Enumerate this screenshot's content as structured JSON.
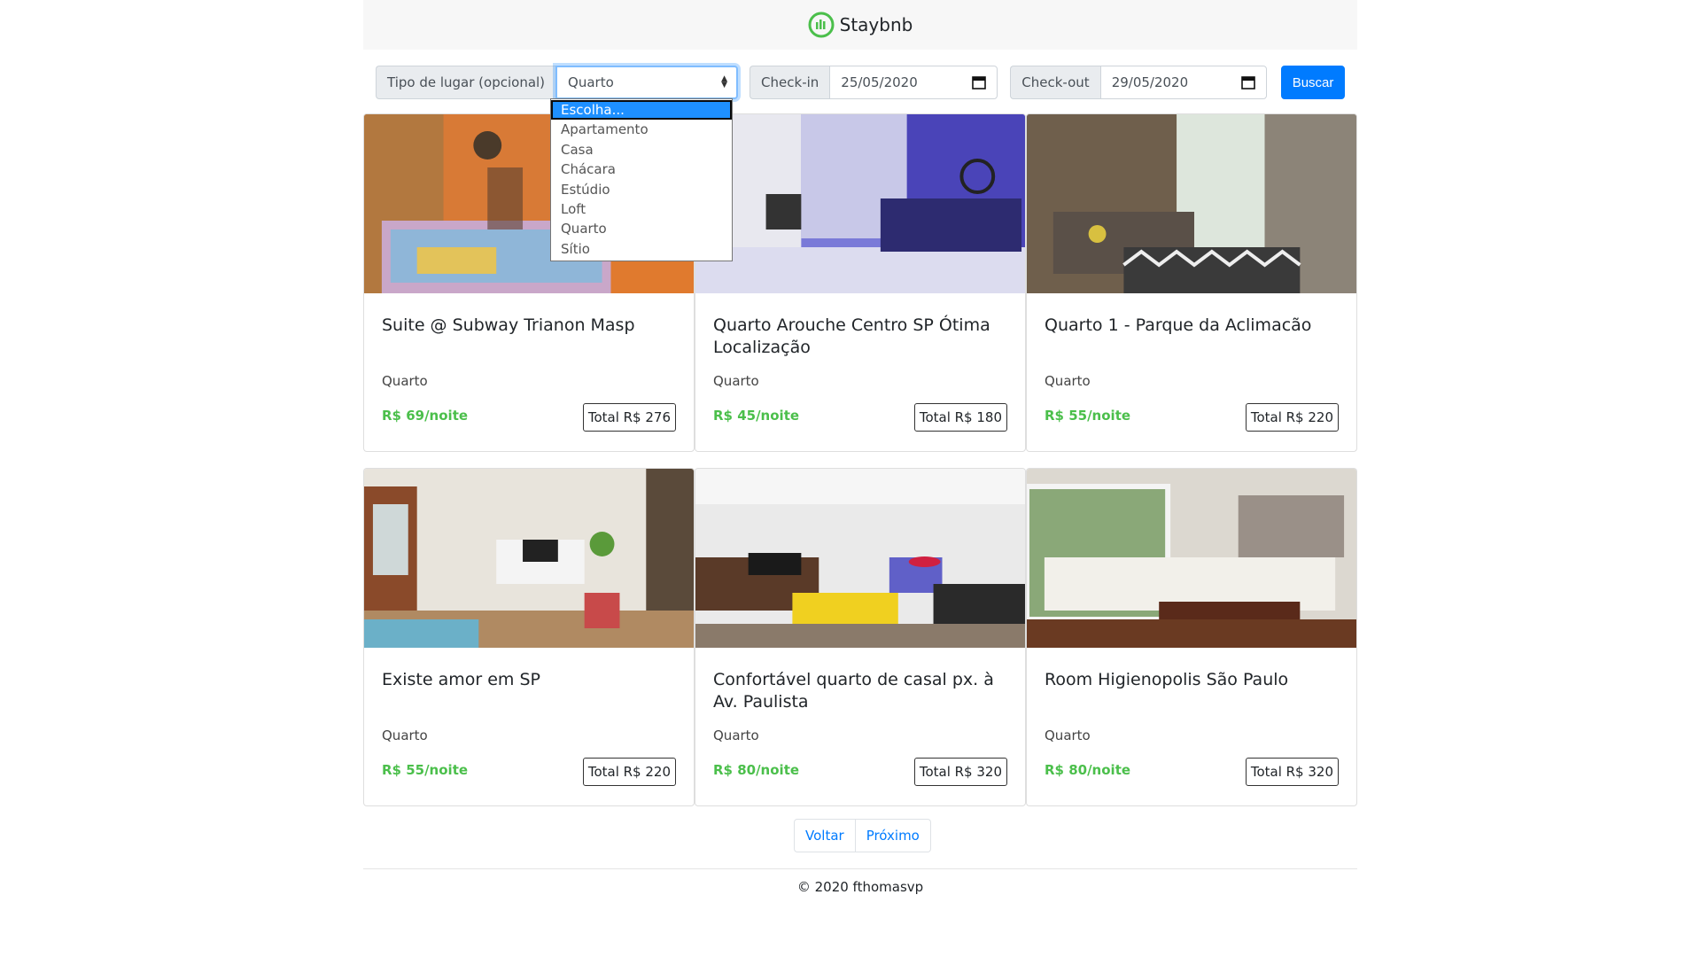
{
  "header": {
    "brand": "Staybnb",
    "logo_icon": "staybnb-logo-icon",
    "accent": "#4bbf4b"
  },
  "search": {
    "type_label": "Tipo de lugar (opcional)",
    "type_value": "Quarto",
    "checkin_label": "Check-in",
    "checkin_value": "25/05/2020",
    "checkout_label": "Check-out",
    "checkout_value": "29/05/2020",
    "button": "Buscar",
    "button_color": "#007bff"
  },
  "dropdown": {
    "options": [
      "Escolha...",
      "Apartamento",
      "Casa",
      "Chácara",
      "Estúdio",
      "Loft",
      "Quarto",
      "Sítio"
    ],
    "highlighted": "Escolha..."
  },
  "listings": [
    {
      "title": "Suite @ Subway Trianon Masp",
      "type": "Quarto",
      "price": "R$ 69/noite",
      "total": "Total R$ 276"
    },
    {
      "title": "Quarto Arouche Centro SP Ótima Localização",
      "type": "Quarto",
      "price": "R$ 45/noite",
      "total": "Total R$ 180"
    },
    {
      "title": "Quarto 1 - Parque da Aclimacão",
      "type": "Quarto",
      "price": "R$ 55/noite",
      "total": "Total R$ 220"
    },
    {
      "title": "Existe amor em SP",
      "type": "Quarto",
      "price": "R$ 55/noite",
      "total": "Total R$ 220"
    },
    {
      "title": "Confortável quarto de casal px. à Av. Paulista",
      "type": "Quarto",
      "price": "R$ 80/noite",
      "total": "Total R$ 320"
    },
    {
      "title": "Room Higienopolis São Paulo",
      "type": "Quarto",
      "price": "R$ 80/noite",
      "total": "Total R$ 320"
    }
  ],
  "pagination": {
    "prev": "Voltar",
    "next": "Próximo"
  },
  "footer": {
    "text": "© 2020 fthomasvp"
  }
}
